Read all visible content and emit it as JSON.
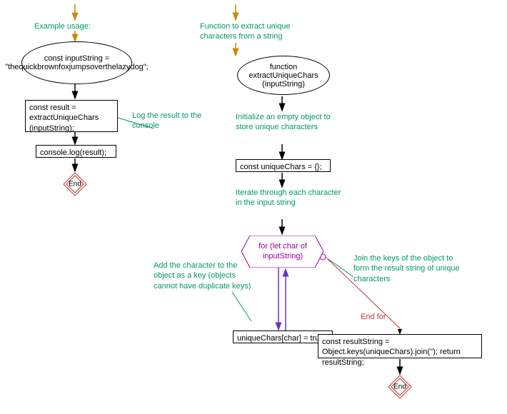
{
  "left": {
    "comment_top": "Example usage:",
    "ellipse_code": "const inputString = \"thequickbrownfoxjumpsoverthelazydog\";",
    "rect_result": "const result = extractUniqueChars (inputString);",
    "rect_log": "console.log(result);",
    "comment_log": "Log the result to the console",
    "end": "End"
  },
  "right": {
    "comment_func": "Function to extract unique characters from a string",
    "ellipse_func": "function extractUniqueChars (inputString)",
    "comment_init": "Initialize an empty object to store unique characters",
    "rect_init": "const uniqueChars = {};",
    "comment_iter": "Iterate through each character in the input string",
    "hex_for": "for (let char of inputString)",
    "comment_add": "Add the character to the object as a key (objects cannot have duplicate keys)",
    "rect_assign": "uniqueChars[char] = true;",
    "comment_join": "Join the keys of the object to form the result string of unique characters",
    "rect_return": "const resultString = Object.keys(uniqueChars).join(''); return resultString;",
    "endfor": "End for",
    "end": "End"
  }
}
